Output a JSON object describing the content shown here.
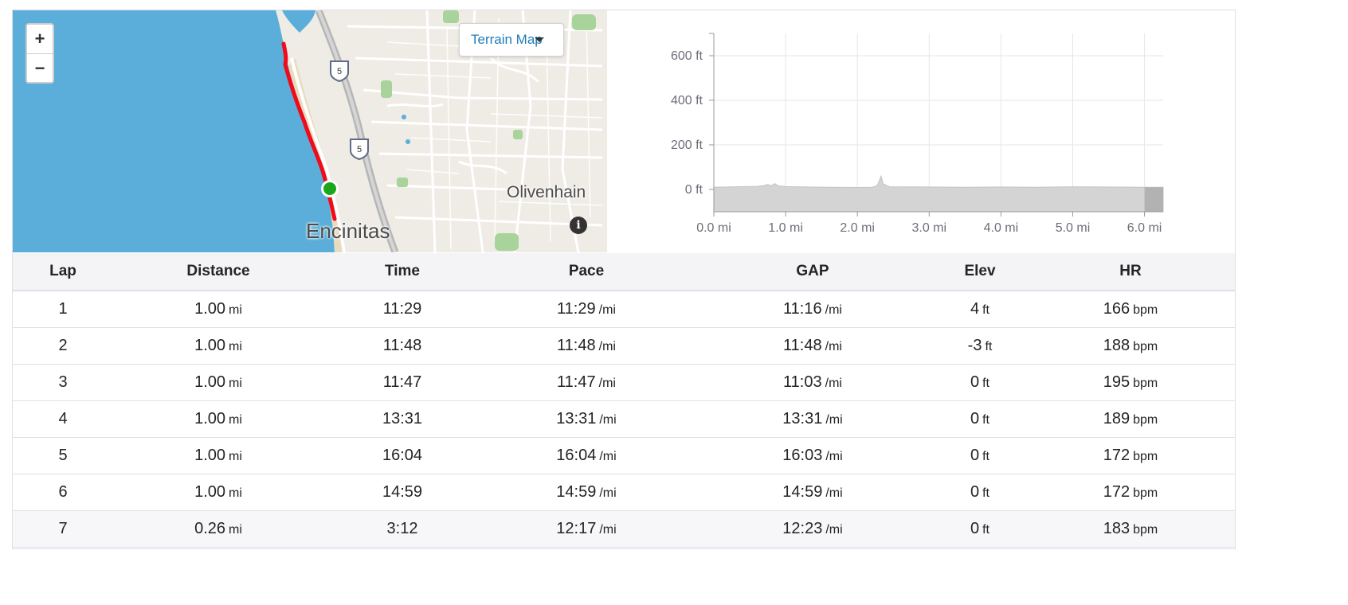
{
  "map": {
    "zoom_in_label": "+",
    "zoom_out_label": "−",
    "map_type_label": "Terrain Map",
    "info_label": "i",
    "places": [
      "Olivenhain",
      "Encinitas"
    ],
    "highway_shields": [
      "5",
      "5"
    ],
    "route_color": "#f00a1b",
    "start_marker_color": "#1aa81a",
    "water_color": "#5aaed9"
  },
  "elevation_chart": {
    "chart_data": {
      "type": "area",
      "x_ticks": [
        "0.0 mi",
        "1.0 mi",
        "2.0 mi",
        "3.0 mi",
        "4.0 mi",
        "5.0 mi",
        "6.0 mi"
      ],
      "y_ticks": [
        "600 ft",
        "400 ft",
        "200 ft",
        "0 ft"
      ],
      "xlim": [
        0,
        6.26
      ],
      "ylim": [
        -100,
        700
      ],
      "grid": true,
      "series": [
        {
          "x": [
            0,
            0.3,
            0.6,
            0.7,
            0.75,
            0.8,
            0.85,
            0.9,
            1.0,
            1.3,
            1.6,
            2.0,
            2.2,
            2.25,
            2.28,
            2.3,
            2.33,
            2.36,
            2.45,
            3.0,
            3.5,
            4.0,
            4.5,
            5.0,
            5.5,
            6.0,
            6.26
          ],
          "y": [
            10,
            12,
            14,
            18,
            22,
            17,
            26,
            16,
            13,
            11,
            10,
            9,
            10,
            14,
            20,
            35,
            60,
            25,
            12,
            11,
            10,
            11,
            10,
            12,
            11,
            10,
            10
          ]
        }
      ]
    }
  },
  "laps": {
    "headers": [
      "Lap",
      "Distance",
      "Time",
      "Pace",
      "GAP",
      "Elev",
      "HR"
    ],
    "rows": [
      {
        "lap": "1",
        "distance": "1.00",
        "distance_unit": "mi",
        "time": "11:29",
        "pace": "11:29",
        "pace_unit": "/mi",
        "gap": "11:16",
        "gap_unit": "/mi",
        "elev": "4",
        "elev_unit": "ft",
        "hr": "166",
        "hr_unit": "bpm"
      },
      {
        "lap": "2",
        "distance": "1.00",
        "distance_unit": "mi",
        "time": "11:48",
        "pace": "11:48",
        "pace_unit": "/mi",
        "gap": "11:48",
        "gap_unit": "/mi",
        "elev": "-3",
        "elev_unit": "ft",
        "hr": "188",
        "hr_unit": "bpm"
      },
      {
        "lap": "3",
        "distance": "1.00",
        "distance_unit": "mi",
        "time": "11:47",
        "pace": "11:47",
        "pace_unit": "/mi",
        "gap": "11:03",
        "gap_unit": "/mi",
        "elev": "0",
        "elev_unit": "ft",
        "hr": "195",
        "hr_unit": "bpm"
      },
      {
        "lap": "4",
        "distance": "1.00",
        "distance_unit": "mi",
        "time": "13:31",
        "pace": "13:31",
        "pace_unit": "/mi",
        "gap": "13:31",
        "gap_unit": "/mi",
        "elev": "0",
        "elev_unit": "ft",
        "hr": "189",
        "hr_unit": "bpm"
      },
      {
        "lap": "5",
        "distance": "1.00",
        "distance_unit": "mi",
        "time": "16:04",
        "pace": "16:04",
        "pace_unit": "/mi",
        "gap": "16:03",
        "gap_unit": "/mi",
        "elev": "0",
        "elev_unit": "ft",
        "hr": "172",
        "hr_unit": "bpm"
      },
      {
        "lap": "6",
        "distance": "1.00",
        "distance_unit": "mi",
        "time": "14:59",
        "pace": "14:59",
        "pace_unit": "/mi",
        "gap": "14:59",
        "gap_unit": "/mi",
        "elev": "0",
        "elev_unit": "ft",
        "hr": "172",
        "hr_unit": "bpm"
      },
      {
        "lap": "7",
        "distance": "0.26",
        "distance_unit": "mi",
        "time": "3:12",
        "pace": "12:17",
        "pace_unit": "/mi",
        "gap": "12:23",
        "gap_unit": "/mi",
        "elev": "0",
        "elev_unit": "ft",
        "hr": "183",
        "hr_unit": "bpm"
      }
    ]
  }
}
